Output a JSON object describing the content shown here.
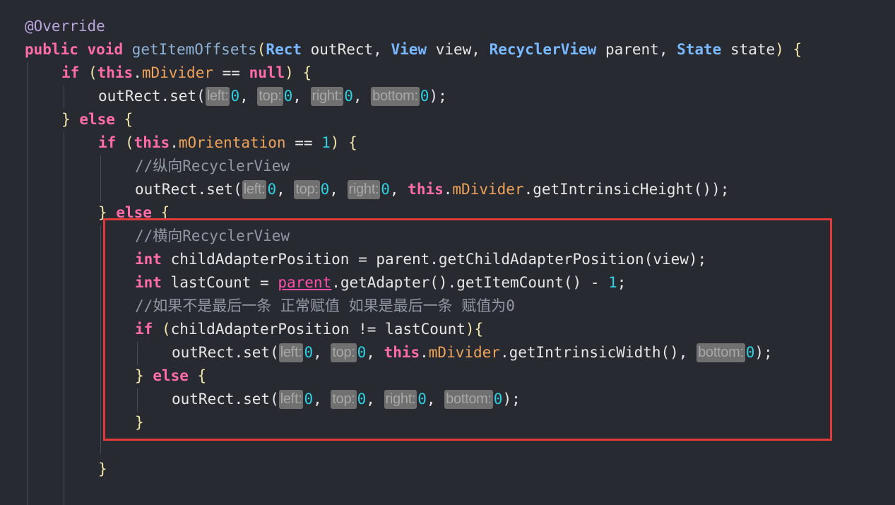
{
  "code": {
    "annotation": "@Override",
    "kw_public": "public",
    "kw_void": "void",
    "kw_if": "if",
    "kw_this": "this",
    "kw_null": "null",
    "kw_else": "else",
    "kw_int": "int",
    "method_name": "getItemOffsets",
    "type_rect": "Rect",
    "type_view": "View",
    "type_recyclerview": "RecyclerView",
    "type_state": "State",
    "param_outrect": "outRect",
    "param_view": "view",
    "param_parent": "parent",
    "param_state": "state",
    "field_mdivider": "mDivider",
    "field_morientation": "mOrientation",
    "call_outrect_set": "outRect.set(",
    "call_get_intrinsic_height": ".getIntrinsicHeight());",
    "call_get_intrinsic_width": ".getIntrinsicWidth(),",
    "call_get_child_adapter_position": "parent.getChildAdapterPosition(view);",
    "call_get_adapter": ".getAdapter().getItemCount() - ",
    "var_child_adapter_position": "childAdapterPosition",
    "var_last_count": "lastCount",
    "comment_vertical": "//纵向RecyclerView",
    "comment_horizontal": "//横向RecyclerView",
    "comment_last_item": "//如果不是最后一条 正常赋值 如果是最后一条 赋值为0",
    "hint_left": "left:",
    "hint_top": "top:",
    "hint_right": "right:",
    "hint_bottom": "bottom:",
    "num_zero": "0",
    "num_one": "1"
  },
  "colors": {
    "background": "#272a31",
    "keyword": "#ff6ca6",
    "type": "#79b8ff",
    "field": "#f0a35a",
    "number": "#2fd0e0",
    "comment": "#9197a3",
    "highlight_border": "#e03a3a"
  }
}
